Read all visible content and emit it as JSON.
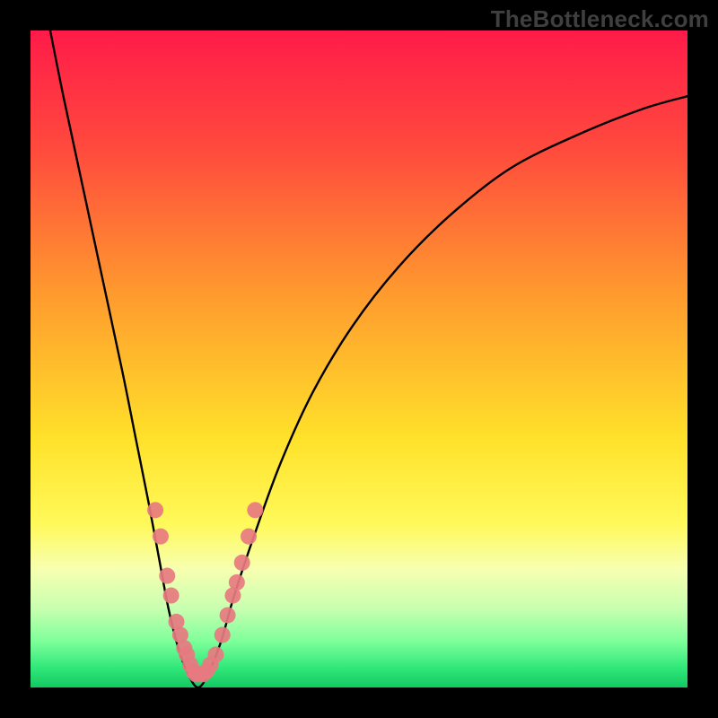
{
  "watermark": "TheBottleneck.com",
  "chart_data": {
    "type": "line",
    "title": "",
    "xlabel": "",
    "ylabel": "",
    "xlim": [
      0,
      100
    ],
    "ylim": [
      0,
      100
    ],
    "gradient_stops": [
      {
        "pct": 0,
        "color": "#ff1b49"
      },
      {
        "pct": 18,
        "color": "#ff4a3d"
      },
      {
        "pct": 40,
        "color": "#ff9a2e"
      },
      {
        "pct": 62,
        "color": "#ffe12a"
      },
      {
        "pct": 75,
        "color": "#fff959"
      },
      {
        "pct": 82,
        "color": "#f7ffb0"
      },
      {
        "pct": 88,
        "color": "#c8ffb0"
      },
      {
        "pct": 93,
        "color": "#7dff9a"
      },
      {
        "pct": 97,
        "color": "#30e87a"
      },
      {
        "pct": 100,
        "color": "#14c862"
      }
    ],
    "series": [
      {
        "name": "bottleneck-curve",
        "x": [
          3,
          5,
          8,
          11,
          14,
          16,
          18,
          19.5,
          21,
          22.5,
          24,
          25.5,
          27,
          29,
          31,
          34,
          38,
          43,
          49,
          56,
          64,
          73,
          83,
          93,
          100
        ],
        "y": [
          100,
          90,
          76,
          62,
          48,
          38,
          28,
          20,
          12,
          6,
          2,
          0,
          2,
          7,
          14,
          23,
          34,
          45,
          55,
          64,
          72,
          79,
          84,
          88,
          90
        ]
      }
    ],
    "scatter": {
      "name": "highlight-dots",
      "color": "#e77a80",
      "points": [
        {
          "x": 19.0,
          "y": 27
        },
        {
          "x": 19.8,
          "y": 23
        },
        {
          "x": 20.8,
          "y": 17
        },
        {
          "x": 21.4,
          "y": 14
        },
        {
          "x": 22.2,
          "y": 10
        },
        {
          "x": 22.8,
          "y": 8
        },
        {
          "x": 23.4,
          "y": 6
        },
        {
          "x": 23.8,
          "y": 5
        },
        {
          "x": 24.3,
          "y": 3.5
        },
        {
          "x": 24.8,
          "y": 2.5
        },
        {
          "x": 25.2,
          "y": 2
        },
        {
          "x": 25.7,
          "y": 2
        },
        {
          "x": 26.2,
          "y": 2
        },
        {
          "x": 26.8,
          "y": 2.5
        },
        {
          "x": 27.4,
          "y": 3.5
        },
        {
          "x": 28.2,
          "y": 5
        },
        {
          "x": 29.2,
          "y": 8
        },
        {
          "x": 30.0,
          "y": 11
        },
        {
          "x": 30.8,
          "y": 14
        },
        {
          "x": 31.4,
          "y": 16
        },
        {
          "x": 32.2,
          "y": 19
        },
        {
          "x": 33.2,
          "y": 23
        },
        {
          "x": 34.2,
          "y": 27
        }
      ]
    }
  }
}
